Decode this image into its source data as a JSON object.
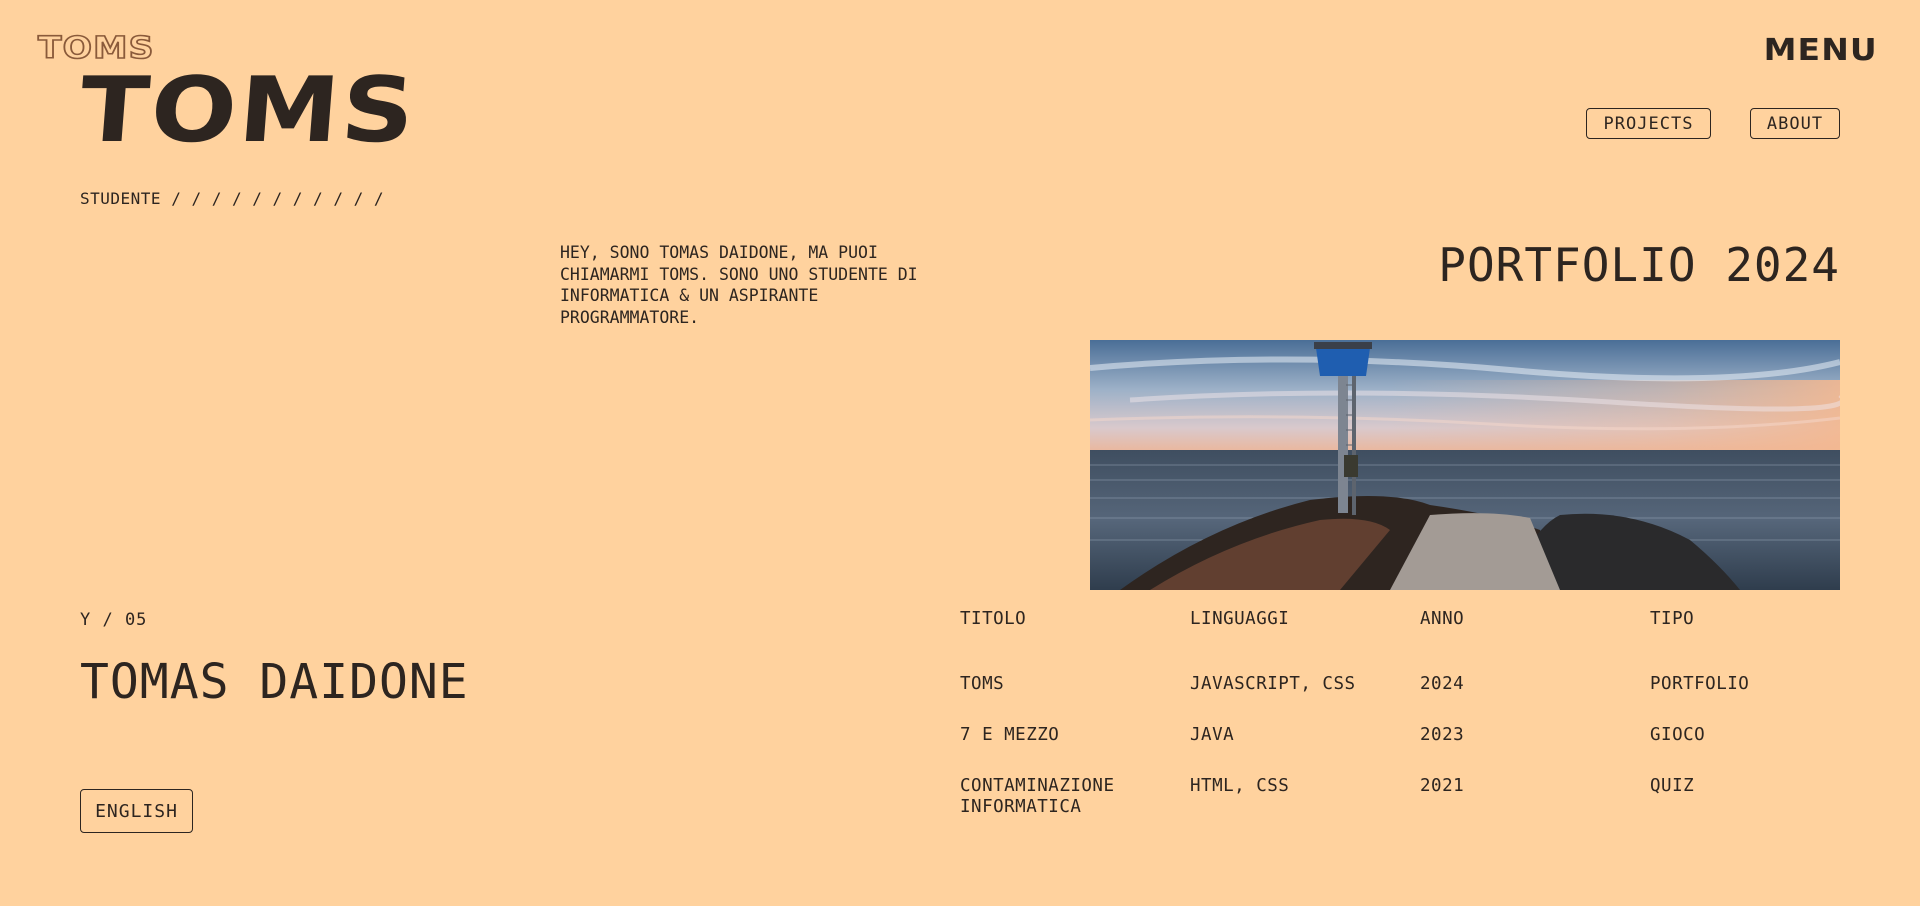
{
  "header": {
    "logo_small": "TOMS",
    "logo_big": "TOMS",
    "menu_label": "MENU",
    "nav": [
      {
        "label": "PROJECTS"
      },
      {
        "label": "ABOUT"
      }
    ]
  },
  "subtitle": "STUDENTE / / / / / / / / / / /",
  "intro": "HEY, SONO TOMAS DAIDONE, MA PUOI CHIAMARMI TOMS. SONO UNO STUDENTE DI INFORMATICA & UN ASPIRANTE PROGRAMMATORE.",
  "portfolio_title": "PORTFOLIO 2024",
  "profile": {
    "year": "Y / 05",
    "name": "TOMAS DAIDONE",
    "language_button": "ENGLISH"
  },
  "projects": {
    "headers": [
      "TITOLO",
      "LINGUAGGI",
      "ANNO",
      "TIPO"
    ],
    "rows": [
      [
        "TOMS",
        "JAVASCRIPT, CSS",
        "2024",
        "PORTFOLIO"
      ],
      [
        "7 E MEZZO",
        "JAVA",
        "2023",
        "GIOCO"
      ],
      [
        "CONTAMINAZIONE INFORMATICA",
        "HTML, CSS",
        "2021",
        "QUIZ"
      ]
    ]
  },
  "colors": {
    "background": "#ffd29e",
    "text": "#2d2520",
    "logo_outline": "#8a5a3a"
  }
}
